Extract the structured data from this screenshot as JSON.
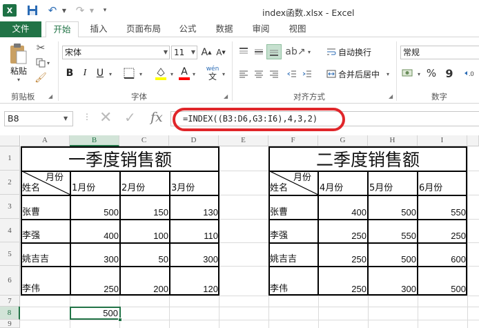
{
  "window": {
    "excel_logo": "X",
    "title": "index函数.xlsx - Excel"
  },
  "qat": {
    "save_icon": "save-icon",
    "undo_icon": "undo-icon",
    "redo_icon": "redo-icon"
  },
  "tabs": [
    "文件",
    "开始",
    "插入",
    "页面布局",
    "公式",
    "数据",
    "审阅",
    "视图"
  ],
  "ribbon": {
    "clipboard": {
      "paste_label": "粘贴",
      "group_label": "剪贴板"
    },
    "font": {
      "font_name": "宋体",
      "font_size": "11",
      "bold": "B",
      "italic": "I",
      "underline": "U",
      "grow": "A",
      "shrink": "A",
      "phonetic": "wén",
      "group_label": "字体"
    },
    "alignment": {
      "wrap_text": "自动换行",
      "merge_center": "合并后居中",
      "group_label": "对齐方式"
    },
    "number": {
      "format": "常规",
      "percent": "%",
      "comma": "9",
      "group_label": "数字"
    },
    "colors": {
      "accent": "#217346",
      "fill_yellow": "#ffff00",
      "font_red": "#ff0000",
      "highlight_oval": "#e0262a"
    }
  },
  "formula_bar": {
    "name_box": "B8",
    "fx": "fx",
    "formula": "=INDEX((B3:D6,G3:I6),4,3,2)"
  },
  "sheet": {
    "columns": [
      "A",
      "B",
      "C",
      "D",
      "E",
      "F",
      "G",
      "H",
      "I"
    ],
    "rows": [
      "1",
      "2",
      "3",
      "4",
      "5",
      "6",
      "7",
      "8",
      "9"
    ],
    "table1": {
      "title": "一季度销售额",
      "diag_top": "月份",
      "diag_bottom": "姓名",
      "headers": [
        "1月份",
        "2月份",
        "3月份"
      ],
      "rows": [
        {
          "name": "张曹",
          "values": [
            "500",
            "150",
            "130"
          ]
        },
        {
          "name": "李强",
          "values": [
            "400",
            "100",
            "110"
          ]
        },
        {
          "name": "姚吉吉",
          "values": [
            "300",
            "50",
            "300"
          ]
        },
        {
          "name": "李伟",
          "values": [
            "250",
            "200",
            "120"
          ]
        }
      ]
    },
    "table2": {
      "title": "二季度销售额",
      "diag_top": "月份",
      "diag_bottom": "姓名",
      "headers": [
        "4月份",
        "5月份",
        "6月份"
      ],
      "rows": [
        {
          "name": "张曹",
          "values": [
            "400",
            "500",
            "550"
          ]
        },
        {
          "name": "李强",
          "values": [
            "250",
            "550",
            "250"
          ]
        },
        {
          "name": "姚吉吉",
          "values": [
            "250",
            "500",
            "600"
          ]
        },
        {
          "name": "李伟",
          "values": [
            "250",
            "300",
            "500"
          ]
        }
      ]
    },
    "b8_value": "500"
  }
}
